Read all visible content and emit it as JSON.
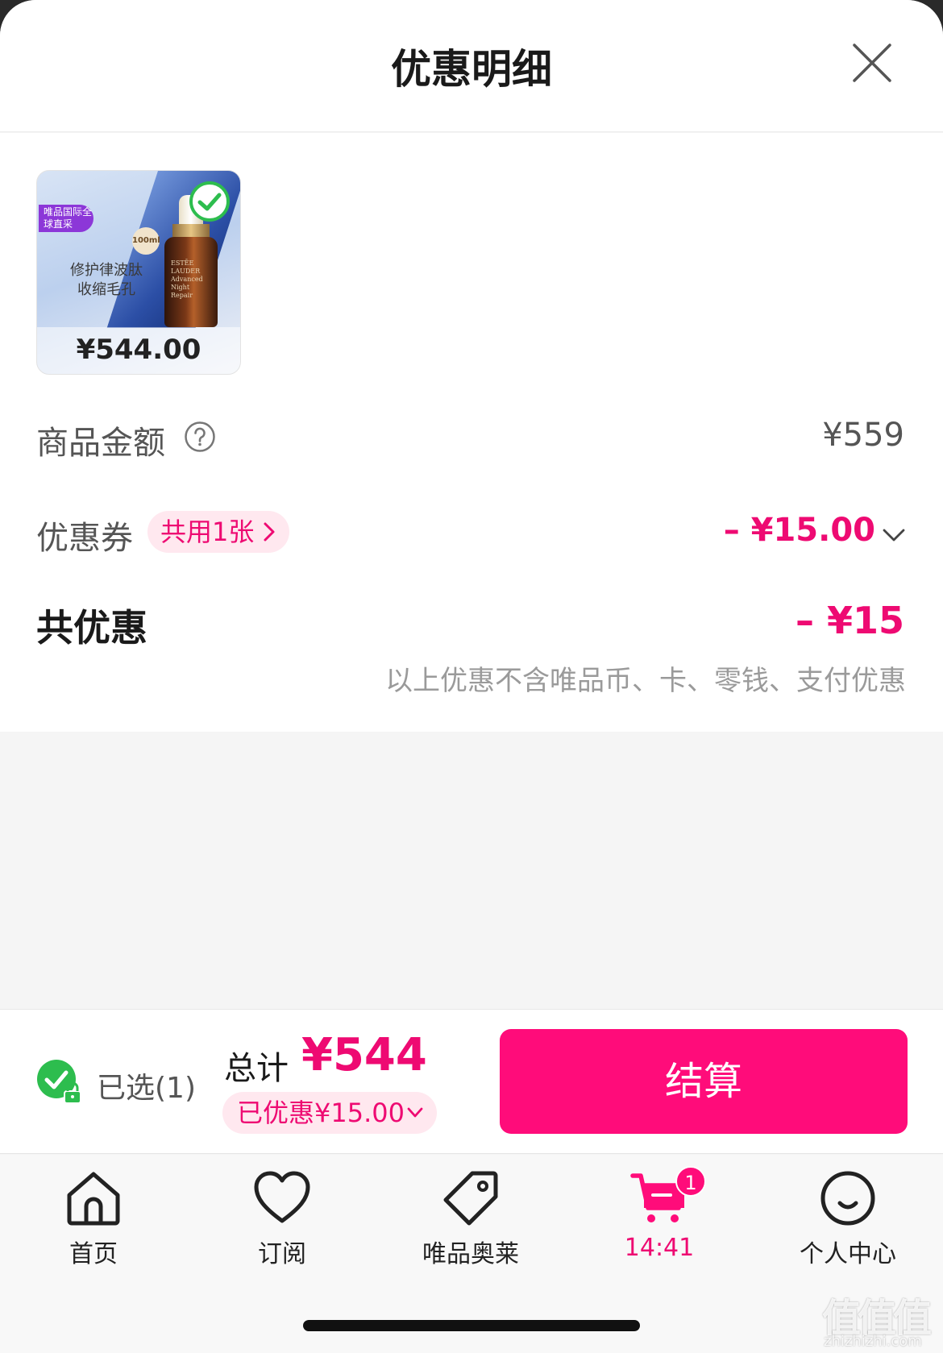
{
  "header": {
    "title": "优惠明细"
  },
  "product": {
    "badge": "唯品国际全球直采",
    "size": "100ml",
    "slogan_line1": "修护律波肽",
    "slogan_line2": "收缩毛孔",
    "bottle_label": "ESTĒE LAUDER Advanced Night Repair",
    "price": "¥544.00",
    "selected": true
  },
  "summary": {
    "goods_amount_label": "商品金额",
    "goods_amount_value": "¥559",
    "coupon_label": "优惠券",
    "coupon_tag": "共用1张",
    "coupon_value": "– ¥15.00",
    "total_discount_label": "共优惠",
    "total_discount_value": "– ¥15",
    "note": "以上优惠不含唯品币、卡、零钱、支付优惠"
  },
  "checkout": {
    "selected_label": "已选(1)",
    "sum_label": "总计",
    "sum_value": "¥544",
    "saved": "已优惠¥15.00",
    "button": "结算"
  },
  "tabs": [
    {
      "label": "首页",
      "icon": "home-icon",
      "active": false
    },
    {
      "label": "订阅",
      "icon": "heart-icon",
      "active": false
    },
    {
      "label": "唯品奥莱",
      "icon": "tag-icon",
      "active": false
    },
    {
      "label": "14:41",
      "icon": "cart-icon",
      "active": true,
      "badge": "1"
    },
    {
      "label": "个人中心",
      "icon": "smiley-icon",
      "active": false
    }
  ],
  "watermark": {
    "big": "值值值",
    "small": "zhizhizhi.com"
  },
  "colors": {
    "accent": "#ff0c7a",
    "accent_text": "#ee0a72",
    "pill_bg": "#ffe8ef",
    "check_green": "#2dbd4e"
  }
}
